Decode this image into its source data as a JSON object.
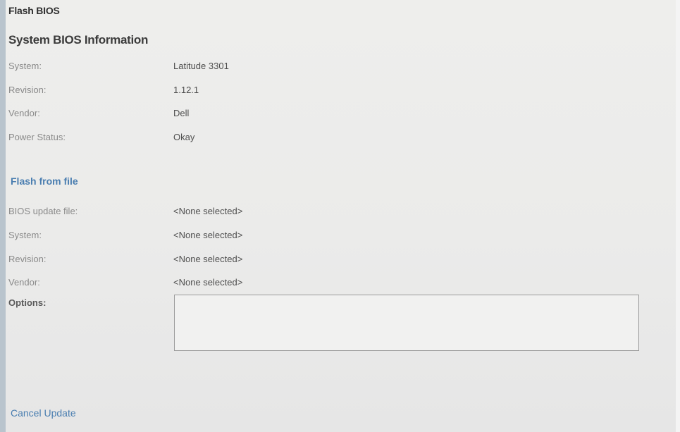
{
  "page": {
    "title": "Flash BIOS"
  },
  "system_info": {
    "heading": "System BIOS Information",
    "rows": [
      {
        "label": "System:",
        "value": "Latitude 3301"
      },
      {
        "label": "Revision:",
        "value": "1.12.1"
      },
      {
        "label": "Vendor:",
        "value": "Dell"
      },
      {
        "label": "Power Status:",
        "value": "Okay"
      }
    ]
  },
  "flash_from_file": {
    "link_label": "Flash from file",
    "rows": [
      {
        "label": "BIOS update file:",
        "value": "<None selected>"
      },
      {
        "label": "System:",
        "value": "<None selected>"
      },
      {
        "label": "Revision:",
        "value": "<None selected>"
      },
      {
        "label": "Vendor:",
        "value": "<None selected>"
      }
    ],
    "options_label": "Options:"
  },
  "footer": {
    "cancel_label": "Cancel Update"
  },
  "colors": {
    "background": "#ececea",
    "link": "#4a7eb0",
    "label": "#8a8a8a",
    "value": "#4e4e4e"
  }
}
